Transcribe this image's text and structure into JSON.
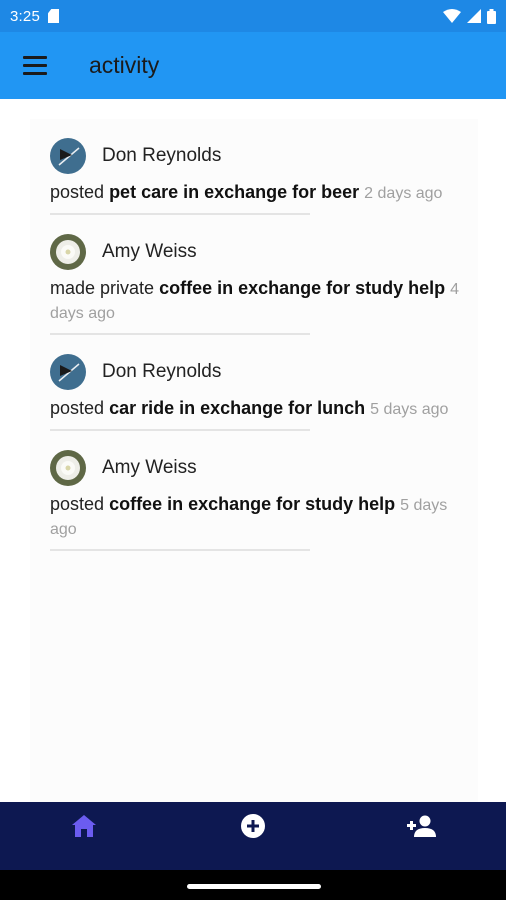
{
  "status_bar": {
    "time": "3:25"
  },
  "app_bar": {
    "title": "activity"
  },
  "activities": [
    {
      "user": "Don Reynolds",
      "avatar": "avatar-flag",
      "action": "posted",
      "item": "pet care in exchange for beer",
      "time": "2 days ago"
    },
    {
      "user": "Amy Weiss",
      "avatar": "avatar-flower",
      "action": "made private",
      "item": "coffee in exchange for study help",
      "time": "4 days ago"
    },
    {
      "user": "Don Reynolds",
      "avatar": "avatar-flag",
      "action": "posted",
      "item": "car ride in exchange for lunch",
      "time": "5 days ago"
    },
    {
      "user": "Amy Weiss",
      "avatar": "avatar-flower",
      "action": "posted",
      "item": "coffee in exchange for study help",
      "time": "5 days ago"
    }
  ],
  "bottom_nav": [
    {
      "icon": "home-icon",
      "active": true
    },
    {
      "icon": "add-circle-icon",
      "active": false
    },
    {
      "icon": "add-person-icon",
      "active": false
    }
  ],
  "colors": {
    "status_bar": "#1e88e5",
    "app_bar": "#2196f3",
    "bottom_nav": "#0d1851",
    "active_nav": "#6b5cf0"
  }
}
